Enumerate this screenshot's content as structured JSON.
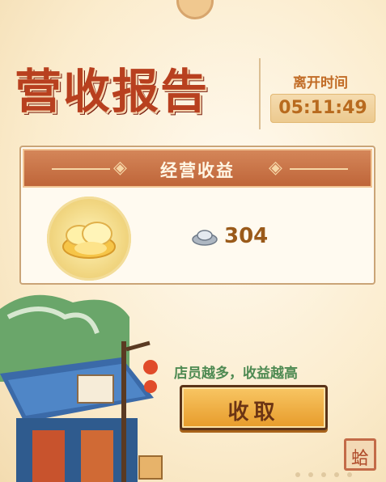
{
  "report": {
    "title": "营收报告",
    "leave_time_label": "离开时间",
    "leave_time_value": "05:11:49"
  },
  "earnings_card": {
    "header": "经营收益",
    "reward_icon": "gold-ingot-icon",
    "currency_icon": "silver-ingot-icon",
    "amount": "304"
  },
  "hint_text": "店员越多，收益越高",
  "collect_button_label": "收取",
  "corner_stamp": "蛤",
  "colors": {
    "title_red": "#b8401f",
    "banner_brown": "#c86d42",
    "button_gold": "#f0b048",
    "hint_green": "#4e8a52",
    "paper": "#fbeccd"
  }
}
